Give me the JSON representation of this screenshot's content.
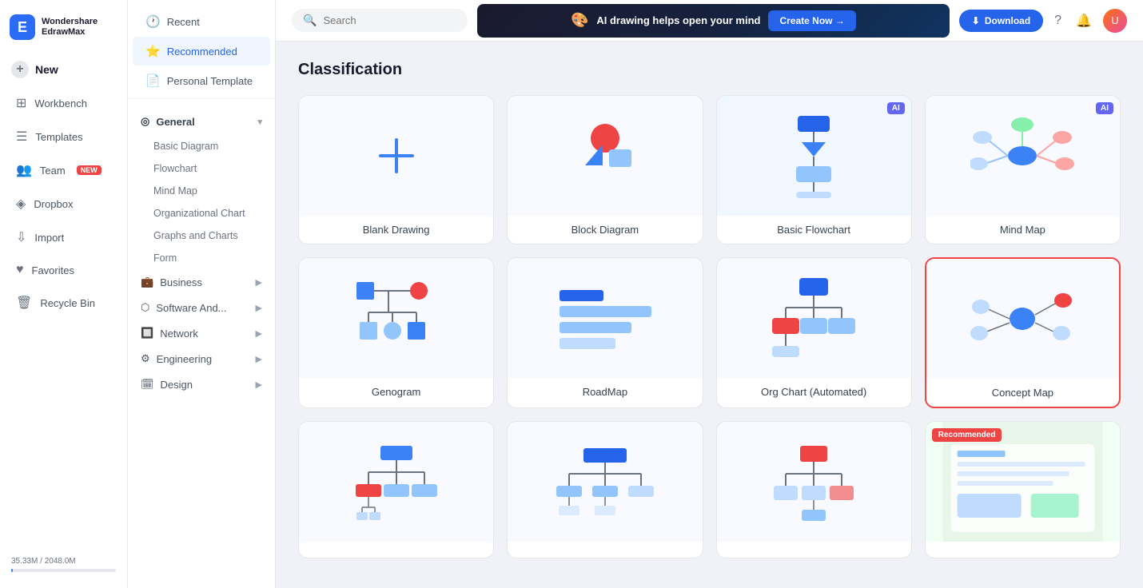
{
  "app": {
    "name": "Wondershare",
    "subtitle": "EdrawMax"
  },
  "topbar": {
    "search_placeholder": "Search",
    "ai_banner_text": "AI drawing helps open your mind",
    "ai_create_label": "Create Now →",
    "download_label": "Download"
  },
  "sidebar": {
    "items": [
      {
        "id": "new",
        "label": "New",
        "icon": "✦"
      },
      {
        "id": "workbench",
        "label": "Workbench",
        "icon": "⊞"
      },
      {
        "id": "templates",
        "label": "Templates",
        "icon": "☰"
      },
      {
        "id": "team",
        "label": "Team",
        "icon": "👥",
        "badge": "NEW"
      },
      {
        "id": "dropbox",
        "label": "Dropbox",
        "icon": "◈"
      },
      {
        "id": "import",
        "label": "Import",
        "icon": "⇩"
      },
      {
        "id": "favorites",
        "label": "Favorites",
        "icon": "♥"
      },
      {
        "id": "recycle",
        "label": "Recycle Bin",
        "icon": "🗑"
      }
    ],
    "storage": {
      "used": "35.33M",
      "total": "2048.0M"
    }
  },
  "middle_panel": {
    "top_items": [
      {
        "id": "recent",
        "label": "Recent",
        "icon": "🕐"
      },
      {
        "id": "recommended",
        "label": "Recommended",
        "icon": "⭐",
        "active": true
      },
      {
        "id": "personal_template",
        "label": "Personal Template",
        "icon": "📄"
      }
    ],
    "categories": [
      {
        "id": "general",
        "label": "General",
        "icon": "◎",
        "expanded": true,
        "sub_items": [
          "Basic Diagram",
          "Flowchart",
          "Mind Map",
          "Organizational Chart",
          "Graphs and Charts",
          "Form"
        ]
      },
      {
        "id": "business",
        "label": "Business",
        "icon": "💼",
        "has_arrow": true
      },
      {
        "id": "software",
        "label": "Software And...",
        "icon": "⬡",
        "has_arrow": true
      },
      {
        "id": "network",
        "label": "Network",
        "icon": "🔲",
        "has_arrow": true
      },
      {
        "id": "engineering",
        "label": "Engineering",
        "icon": "⚙",
        "has_arrow": true
      },
      {
        "id": "design",
        "label": "Design",
        "icon": "🗓",
        "has_arrow": true
      }
    ]
  },
  "content": {
    "title": "Classification",
    "templates": [
      {
        "id": "blank",
        "label": "Blank Drawing",
        "type": "blank",
        "ai": false,
        "selected": false,
        "recommended": false
      },
      {
        "id": "block_diagram",
        "label": "Block Diagram",
        "type": "block",
        "ai": false,
        "selected": false,
        "recommended": false
      },
      {
        "id": "basic_flowchart",
        "label": "Basic Flowchart",
        "type": "flowchart",
        "ai": true,
        "selected": false,
        "recommended": false
      },
      {
        "id": "mind_map",
        "label": "Mind Map",
        "type": "mindmap",
        "ai": true,
        "selected": false,
        "recommended": false
      },
      {
        "id": "genogram",
        "label": "Genogram",
        "type": "genogram",
        "ai": false,
        "selected": false,
        "recommended": false
      },
      {
        "id": "roadmap",
        "label": "RoadMap",
        "type": "roadmap",
        "ai": false,
        "selected": false,
        "recommended": false
      },
      {
        "id": "org_chart",
        "label": "Org Chart (Automated)",
        "type": "orgchart",
        "ai": false,
        "selected": false,
        "recommended": false
      },
      {
        "id": "concept_map",
        "label": "Concept Map",
        "type": "conceptmap",
        "ai": false,
        "selected": true,
        "recommended": false
      },
      {
        "id": "row9_1",
        "label": "",
        "type": "tree1",
        "ai": false,
        "selected": false,
        "recommended": false
      },
      {
        "id": "row9_2",
        "label": "",
        "type": "wbs",
        "ai": false,
        "selected": false,
        "recommended": false
      },
      {
        "id": "row9_3",
        "label": "",
        "type": "tree2",
        "ai": false,
        "selected": false,
        "recommended": false
      },
      {
        "id": "row9_4",
        "label": "Recommended",
        "type": "recommended_preview",
        "ai": false,
        "selected": false,
        "recommended": true
      }
    ]
  }
}
